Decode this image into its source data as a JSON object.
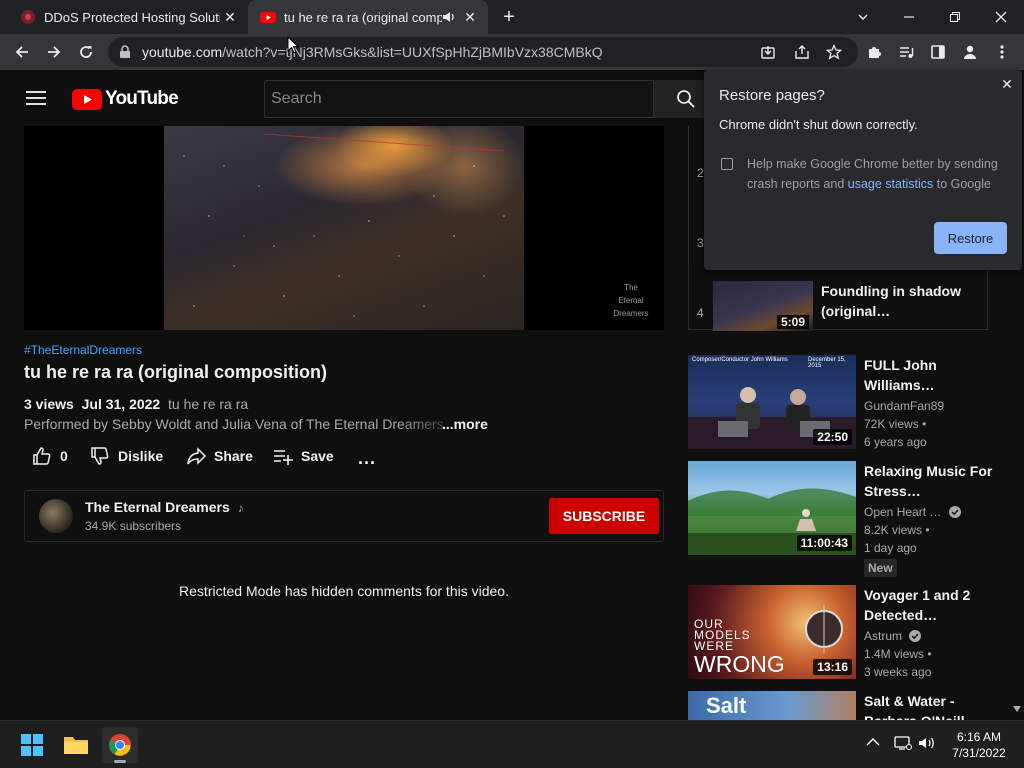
{
  "browser": {
    "tabs": [
      {
        "title": "DDoS Protected Hosting Solution",
        "active": false
      },
      {
        "title": "tu he re ra ra (original compo",
        "active": true,
        "audible": true
      }
    ],
    "url_host": "youtube.com",
    "url_path": "/watch?v=tjNj3RMsGks&list=UUXfSpHhZjBMIbVzx38CMBkQ"
  },
  "masthead": {
    "logo_text": "YouTube",
    "search_placeholder": "Search"
  },
  "player": {
    "watermark_line1": "The",
    "watermark_line2": "Eternal",
    "watermark_line3": "Dreamers"
  },
  "video": {
    "hashtag": "#TheEternalDreamers",
    "title": "tu he re ra ra (original composition)",
    "views": "3 views",
    "date": "Jul 31, 2022",
    "desc_snippet": "tu he re ra ra",
    "desc_line2": "Performed by Sebby Woldt and Julia Vena of The Eternal Dreamers.",
    "more": "...more"
  },
  "actions": {
    "like_count": "0",
    "dislike": "Dislike",
    "share": "Share",
    "save": "Save",
    "more": "..."
  },
  "channel": {
    "name": "The Eternal Dreamers",
    "subscribers": "34.9K subscribers",
    "subscribe": "SUBSCRIBE"
  },
  "comments": {
    "restricted_msg": "Restricted Mode has hidden comments for this video."
  },
  "playlist": {
    "visible_numbers": [
      "2",
      "3",
      "4"
    ],
    "item4_title": "Foundling in shadow (original…",
    "item4_duration": "5:09"
  },
  "recommendations": [
    {
      "title": "FULL John Williams…",
      "channel": "GundamFan89",
      "views": "72K views",
      "age": "6 years ago",
      "duration": "22:50",
      "thumb_text": "Composer/Conductor John Williams",
      "thumb_date": "December 15, 2015"
    },
    {
      "title": "Relaxing Music For Stress…",
      "channel": "Open Heart …",
      "views": "8.2K views",
      "age": "1 day ago",
      "duration": "11:00:43",
      "badge": "New"
    },
    {
      "title": "Voyager 1 and 2 Detected…",
      "channel": "Astrum",
      "views": "1.4M views",
      "age": "3 weeks ago",
      "duration": "13:16",
      "thumb_text1": "OUR",
      "thumb_text2": "MODELS",
      "thumb_text3": "WERE",
      "thumb_text4": "WRONG"
    },
    {
      "title": "Salt & Water - Barbara O'Neill…",
      "thumb_text": "Salt"
    }
  ],
  "popup": {
    "title": "Restore pages?",
    "message": "Chrome didn't shut down correctly.",
    "checkbox_text_a": "Help make Google Chrome better by sending crash reports and",
    "checkbox_link": "usage statistics",
    "checkbox_text_b": "to Google",
    "restore": "Restore"
  },
  "taskbar": {
    "time": "6:16 AM",
    "date": "7/31/2022"
  },
  "colors": {
    "yt_red": "#ff0000",
    "subscribe_red": "#cc0000",
    "link_blue": "#3ea6ff",
    "restore_blue": "#8ab4f8"
  }
}
